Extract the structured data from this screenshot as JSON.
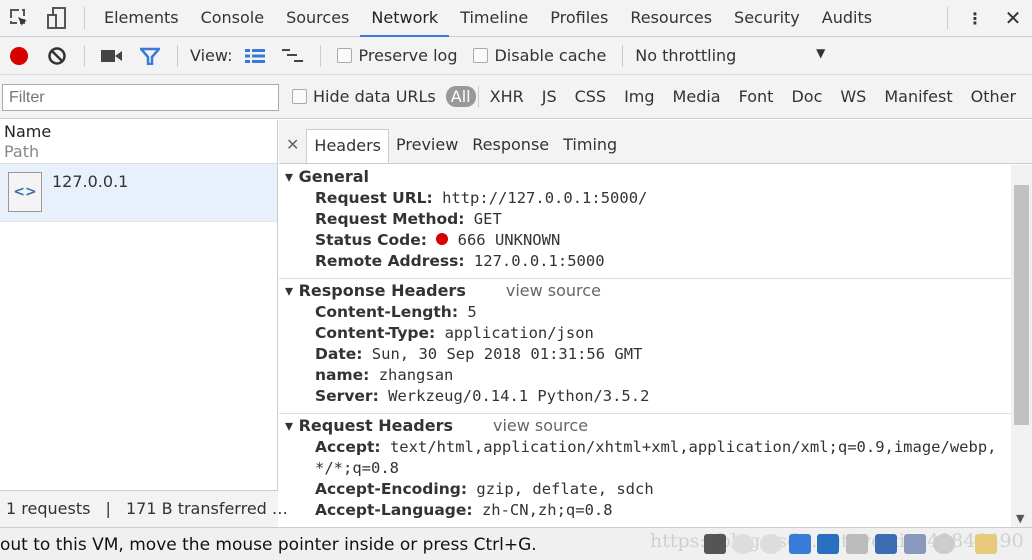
{
  "tabs": [
    "Elements",
    "Console",
    "Sources",
    "Network",
    "Timeline",
    "Profiles",
    "Resources",
    "Security",
    "Audits"
  ],
  "active_tab": "Network",
  "toolbar": {
    "view_label": "View:",
    "preserve_log": "Preserve log",
    "disable_cache": "Disable cache",
    "throttling": "No throttling"
  },
  "filterbar": {
    "placeholder": "Filter",
    "hide_data_urls": "Hide data URLs",
    "types": [
      "All",
      "XHR",
      "JS",
      "CSS",
      "Img",
      "Media",
      "Font",
      "Doc",
      "WS",
      "Manifest",
      "Other"
    ]
  },
  "list": {
    "col_name": "Name",
    "col_path": "Path",
    "items": [
      {
        "name": "127.0.0.1"
      }
    ]
  },
  "status": {
    "requests": "1 requests",
    "sep": "|",
    "transferred": "171 B transferred …"
  },
  "detail_tabs": [
    "Headers",
    "Preview",
    "Response",
    "Timing"
  ],
  "general": {
    "title": "General",
    "rows": [
      {
        "k": "Request URL:",
        "v": "http://127.0.0.1:5000/"
      },
      {
        "k": "Request Method:",
        "v": "GET"
      },
      {
        "k": "Status Code:",
        "v": "666 UNKNOWN"
      },
      {
        "k": "Remote Address:",
        "v": "127.0.0.1:5000"
      }
    ]
  },
  "response_headers": {
    "title": "Response Headers",
    "view_source": "view source",
    "rows": [
      {
        "k": "Content-Length:",
        "v": "5"
      },
      {
        "k": "Content-Type:",
        "v": "application/json"
      },
      {
        "k": "Date:",
        "v": "Sun, 30 Sep 2018 01:31:56 GMT"
      },
      {
        "k": "name:",
        "v": "zhangsan"
      },
      {
        "k": "Server:",
        "v": "Werkzeug/0.14.1 Python/3.5.2"
      }
    ]
  },
  "request_headers": {
    "title": "Request Headers",
    "view_source": "view source",
    "rows": [
      {
        "k": "Accept:",
        "v": "text/html,application/xhtml+xml,application/xml;q=0.9,image/webp,*/*;q=0.8"
      },
      {
        "k": "Accept-Encoding:",
        "v": "gzip, deflate, sdch"
      },
      {
        "k": "Accept-Language:",
        "v": "zh-CN,zh;q=0.8"
      }
    ]
  },
  "vm_status": "out to this VM, move the mouse pointer inside or press Ctrl+G.",
  "watermark": "https://blog.csdn.net/weixin_42844490",
  "colors": {
    "accent": "#3879d9",
    "record": "#d60000",
    "status_dot": "#d60000"
  }
}
